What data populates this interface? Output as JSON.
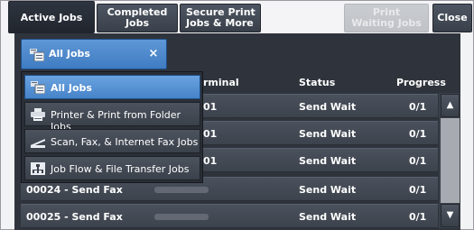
{
  "tabs": {
    "active_jobs": "Active Jobs",
    "completed_jobs_line1": "Completed",
    "completed_jobs_line2": "Jobs",
    "secure_print_line1": "Secure Print",
    "secure_print_line2": "Jobs & More",
    "print_waiting_line1": "Print",
    "print_waiting_line2": "Waiting Jobs",
    "close": "Close"
  },
  "filter": {
    "selected": "All Jobs",
    "clear_glyph": "×"
  },
  "columns": {
    "terminal": "rminal",
    "status": "Status",
    "progress": "Progress"
  },
  "rows": [
    {
      "job": "",
      "terminal_suffix": "01",
      "status": "Send Wait",
      "progress": "0/1"
    },
    {
      "job": "",
      "terminal_suffix": "01",
      "status": "Send Wait",
      "progress": "0/1"
    },
    {
      "job": "",
      "terminal_suffix": "01",
      "status": "Send Wait",
      "progress": "0/1"
    },
    {
      "job": "00024 - Send Fax",
      "terminal_suffix": "",
      "status": "Send Wait",
      "progress": "0/1"
    },
    {
      "job": "00025 - Send Fax",
      "terminal_suffix": "",
      "status": "Send Wait",
      "progress": "0/1"
    }
  ],
  "menu": {
    "items": [
      {
        "label": "All Jobs",
        "icon": "all-jobs-icon",
        "selected": true
      },
      {
        "label": "Printer & Print from Folder Jobs",
        "icon": "printer-icon",
        "selected": false
      },
      {
        "label": "Scan, Fax, & Internet Fax Jobs",
        "icon": "scan-fax-icon",
        "selected": false
      },
      {
        "label": "Job Flow & File Transfer Jobs",
        "icon": "job-flow-icon",
        "selected": false
      }
    ]
  },
  "scroll": {
    "up": "▲",
    "down": "▼"
  },
  "colors": {
    "accent": "#4683c8",
    "panel": "#2f343c",
    "row": "#444a54"
  }
}
